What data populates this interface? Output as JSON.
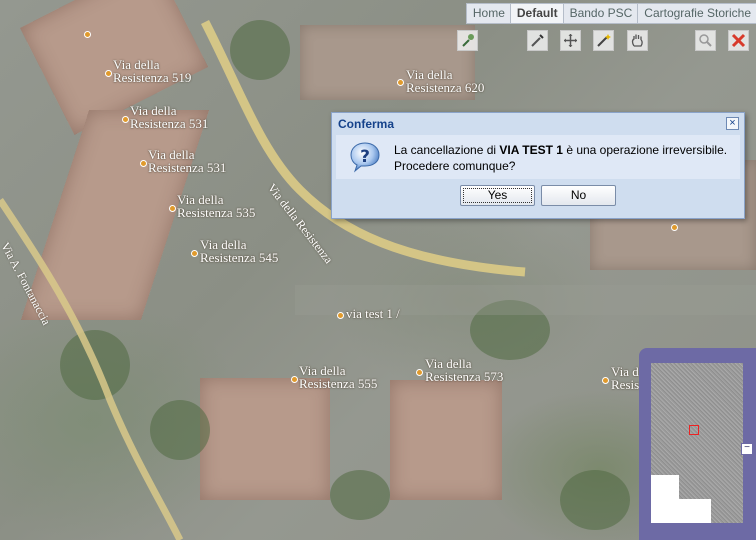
{
  "tabs": [
    "Home",
    "Default",
    "Bando PSC",
    "Cartografie Storiche"
  ],
  "active_tab": "Default",
  "toolbar": {
    "icons": [
      "measure-pin-icon",
      "edit-pencil-icon",
      "pan-arrows-icon",
      "magic-wand-icon",
      "hand-pan-icon",
      "zoom-magnifier-icon",
      "delete-x-icon"
    ]
  },
  "map": {
    "labels": [
      {
        "line1": "Via della",
        "line2": "Resistenza 519"
      },
      {
        "line1": "Via della",
        "line2": "Resistenza 531"
      },
      {
        "line1": "Via della",
        "line2": "Resistenza 531"
      },
      {
        "line1": "Via della",
        "line2": "Resistenza 535"
      },
      {
        "line1": "Via della",
        "line2": "Resistenza 545"
      },
      {
        "line1": "Via della",
        "line2": "Resistenza 620"
      },
      {
        "line1": "Via della",
        "line2": "Resistenza 555"
      },
      {
        "line1": "Via della",
        "line2": "Resistenza 573"
      },
      {
        "line1": "Via d",
        "line2": "Resist"
      },
      {
        "line1": "via test 1 /",
        "line2": ""
      }
    ],
    "road_labels": {
      "resistenza": "Via della Resistenza",
      "fontanaccia": "Via A. Fontanaccia"
    }
  },
  "dialog": {
    "title": "Conferma",
    "close": "×",
    "message_prefix": "La cancellazione di ",
    "message_bold": "VIA TEST 1",
    "message_suffix": " è una operazione irreversibile.",
    "message_line2": "Procedere comunque?",
    "yes": "Yes",
    "no": "No"
  },
  "overview": {
    "toggle": "−"
  }
}
